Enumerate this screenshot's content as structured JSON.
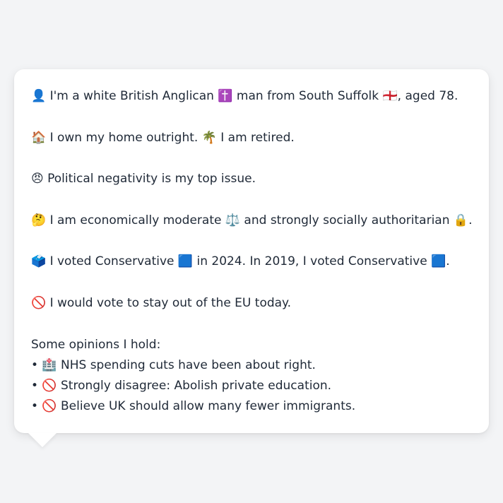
{
  "profile": {
    "identity": "👤 I'm a white British Anglican ✝️ man from South Suffolk 🏴󠁧󠁢󠁥󠁮󠁧󠁿, aged 78.",
    "housing": "🏠 I own my home outright. 🌴 I am retired.",
    "top_issue": "😠 Political negativity is my top issue.",
    "ideology": "🤔 I am economically moderate ⚖️ and strongly socially authoritarian 🔒.",
    "vote_history": "🗳️ I voted Conservative 🟦 in 2024. In 2019, I voted Conservative 🟦.",
    "eu": "🚫 I would vote to stay out of the EU today."
  },
  "opinions": {
    "heading": "Some opinions I hold:",
    "items": [
      "• 🏥 NHS spending cuts have been about right.",
      "• 🚫 Strongly disagree: Abolish private education.",
      "• 🚫 Believe UK should allow many fewer immigrants."
    ]
  }
}
